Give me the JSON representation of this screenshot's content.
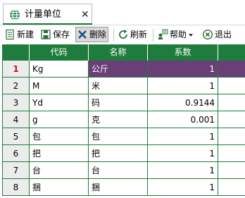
{
  "tab": {
    "title": "计量单位",
    "close": "✕",
    "icon": "globe-icon"
  },
  "toolbar": {
    "new_label": "新建",
    "save_label": "保存",
    "delete_label": "删除",
    "refresh_label": "刷新",
    "help_label": "帮助",
    "exit_label": "退出"
  },
  "grid": {
    "columns": [
      "代码",
      "名称",
      "系数"
    ],
    "selected_row": 1,
    "rows": [
      {
        "num": "1",
        "code": "Kg",
        "name": "公斤",
        "factor": "1"
      },
      {
        "num": "2",
        "code": "M",
        "name": "米",
        "factor": "1"
      },
      {
        "num": "3",
        "code": "Yd",
        "name": "码",
        "factor": "0.9144"
      },
      {
        "num": "4",
        "code": "g",
        "name": "克",
        "factor": "0.001"
      },
      {
        "num": "5",
        "code": "包",
        "name": "包",
        "factor": "1"
      },
      {
        "num": "6",
        "code": "把",
        "name": "把",
        "factor": "1"
      },
      {
        "num": "7",
        "code": "台",
        "name": "台",
        "factor": "1"
      },
      {
        "num": "8",
        "code": "捆",
        "name": "捆",
        "factor": "1"
      }
    ]
  },
  "colors": {
    "accent": "#1e7d3d",
    "selection": "#6a3f78",
    "active_row_number": "#c0141c"
  }
}
